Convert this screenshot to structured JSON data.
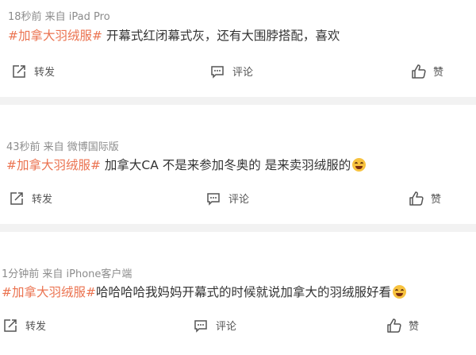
{
  "posts": [
    {
      "meta": "18秒前  来自 iPad Pro",
      "tag": "#加拿大羽绒服#",
      "text": " 开幕式红闭幕式灰，还有大围脖搭配，喜欢",
      "has_emoji": false,
      "actions": {
        "repost": "转发",
        "comment": "评论",
        "like": "赞"
      }
    },
    {
      "meta": "43秒前  来自 微博国际版",
      "tag": "#加拿大羽绒服#",
      "text": " 加拿大CA 不是来参加冬奥的 是来卖羽绒服的",
      "has_emoji": true,
      "emoji": "grin-emoji",
      "actions": {
        "repost": "转发",
        "comment": "评论",
        "like": "赞"
      }
    },
    {
      "meta": "1分钟前  来自 iPhone客户端",
      "tag": "#加拿大羽绒服#",
      "text": "哈哈哈哈我妈妈开幕式的时候就说加拿大的羽绒服好看",
      "has_emoji": true,
      "emoji": "laugh-emoji",
      "actions": {
        "repost": "转发",
        "comment": "评论",
        "like": "赞"
      }
    }
  ],
  "colors": {
    "tag": "#eb7350",
    "text": "#333333",
    "meta": "#8c8c8c",
    "separator": "#f2f2f2"
  }
}
